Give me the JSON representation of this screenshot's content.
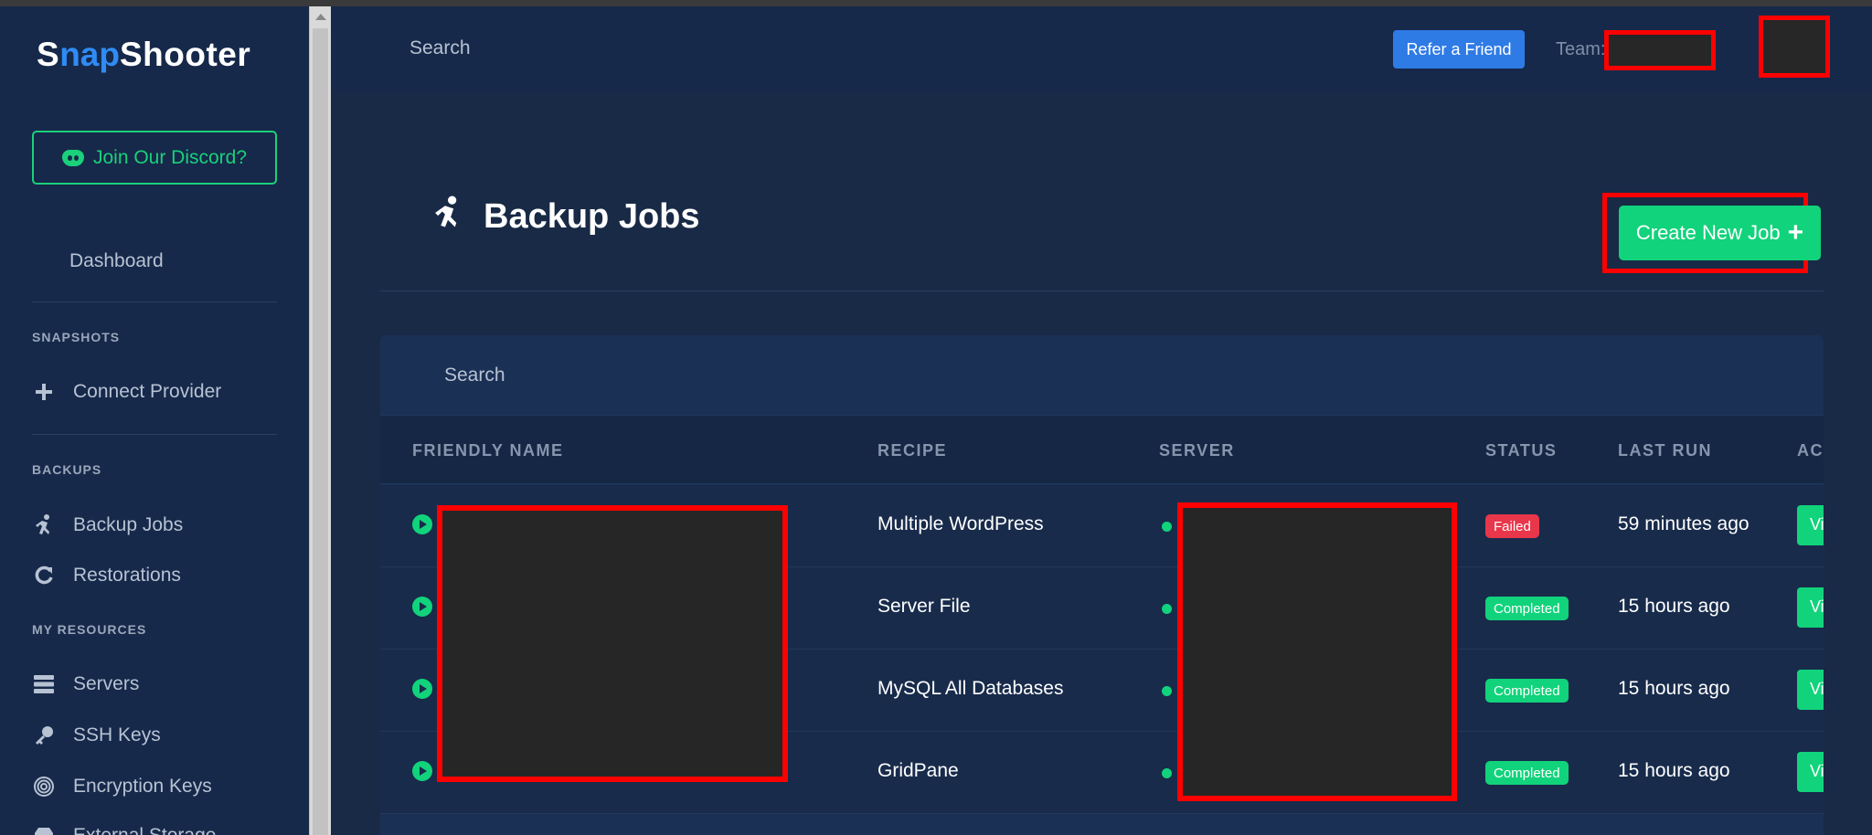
{
  "app": {
    "logo_prefix": "S",
    "logo_accent": "nap",
    "logo_suffix": "Shooter",
    "accent_color": "#11d37b",
    "brand_blue": "#2f8bf5"
  },
  "sidebar": {
    "discord_label": "Join Our Discord?",
    "dashboard_label": "Dashboard",
    "sections": {
      "snapshots": "SNAPSHOTS",
      "backups": "BACKUPS",
      "resources": "MY RESOURCES"
    },
    "items": {
      "connect_provider": "Connect Provider",
      "backup_jobs": "Backup Jobs",
      "restorations": "Restorations",
      "servers": "Servers",
      "ssh_keys": "SSH Keys",
      "encryption_keys": "Encryption Keys",
      "external_storage": "External Storage"
    }
  },
  "topbar": {
    "search_label": "Search",
    "refer_label": "Refer a Friend",
    "team_label": "Team:"
  },
  "main": {
    "title": "Backup Jobs",
    "create_label": "Create New Job",
    "create_plus": "+",
    "panel_search": "Search",
    "columns": {
      "name": "FRIENDLY NAME",
      "recipe": "RECIPE",
      "server": "SERVER",
      "status": "STATUS",
      "last_run": "LAST RUN",
      "actions": "AC"
    },
    "rows": [
      {
        "recipe": "Multiple WordPress",
        "status": "Failed",
        "last_run": "59 minutes ago",
        "action": "Vi"
      },
      {
        "recipe": "Server File",
        "status": "Completed",
        "last_run": "15 hours ago",
        "action": "Vi"
      },
      {
        "recipe": "MySQL All Databases",
        "status": "Completed",
        "last_run": "15 hours ago",
        "action": "Vi"
      },
      {
        "recipe": "GridPane",
        "status": "Completed",
        "last_run": "15 hours ago",
        "action": "Vi"
      }
    ]
  },
  "status_colors": {
    "failed": "#e8364a",
    "completed": "#11d37b"
  }
}
